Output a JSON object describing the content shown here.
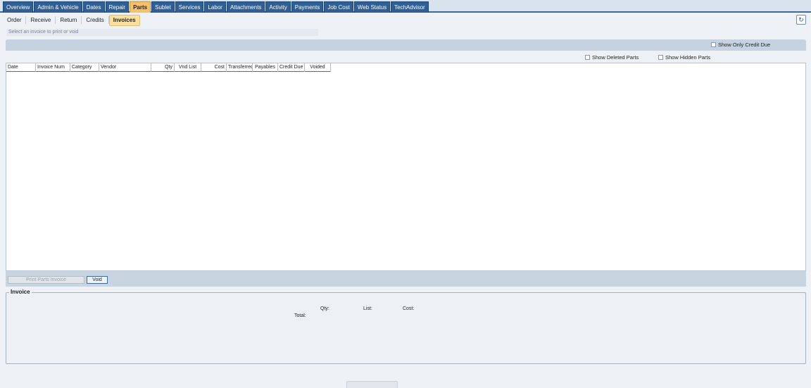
{
  "tabs": [
    {
      "label": "Overview",
      "active": false
    },
    {
      "label": "Admin & Vehicle",
      "active": false
    },
    {
      "label": "Dates",
      "active": false
    },
    {
      "label": "Repair",
      "active": false
    },
    {
      "label": "Parts",
      "active": true
    },
    {
      "label": "Sublet",
      "active": false
    },
    {
      "label": "Services",
      "active": false
    },
    {
      "label": "Labor",
      "active": false
    },
    {
      "label": "Attachments",
      "active": false
    },
    {
      "label": "Activity",
      "active": false
    },
    {
      "label": "Payments",
      "active": false
    },
    {
      "label": "Job Cost",
      "active": false
    },
    {
      "label": "Web Status",
      "active": false
    },
    {
      "label": "TechAdvisor",
      "active": false
    }
  ],
  "subnav": [
    {
      "label": "Order",
      "active": false
    },
    {
      "label": "Receive",
      "active": false
    },
    {
      "label": "Return",
      "active": false
    },
    {
      "label": "Credits",
      "active": false
    },
    {
      "label": "Invoices",
      "active": true
    }
  ],
  "refresh_icon": "refresh-icon",
  "hint": "Select an invoice to print or void",
  "options": {
    "show_only_credit_due": "Show Only Credit Due",
    "show_deleted_parts": "Show Deleted Parts",
    "show_hidden_parts": "Show Hidden Parts"
  },
  "columns": [
    "Date",
    "Invoice Num",
    "Category",
    "Vendor",
    "Qty",
    "Vnd List",
    "Cost",
    "Transferred",
    "Payables",
    "Credit Due",
    "Voided"
  ],
  "buttons": {
    "print": "Print Parts Invoice",
    "void": "Void"
  },
  "invoice": {
    "title": "Invoice",
    "qty_label": "Qty:",
    "list_label": "List:",
    "cost_label": "Cost:",
    "total_label": "Total:"
  }
}
